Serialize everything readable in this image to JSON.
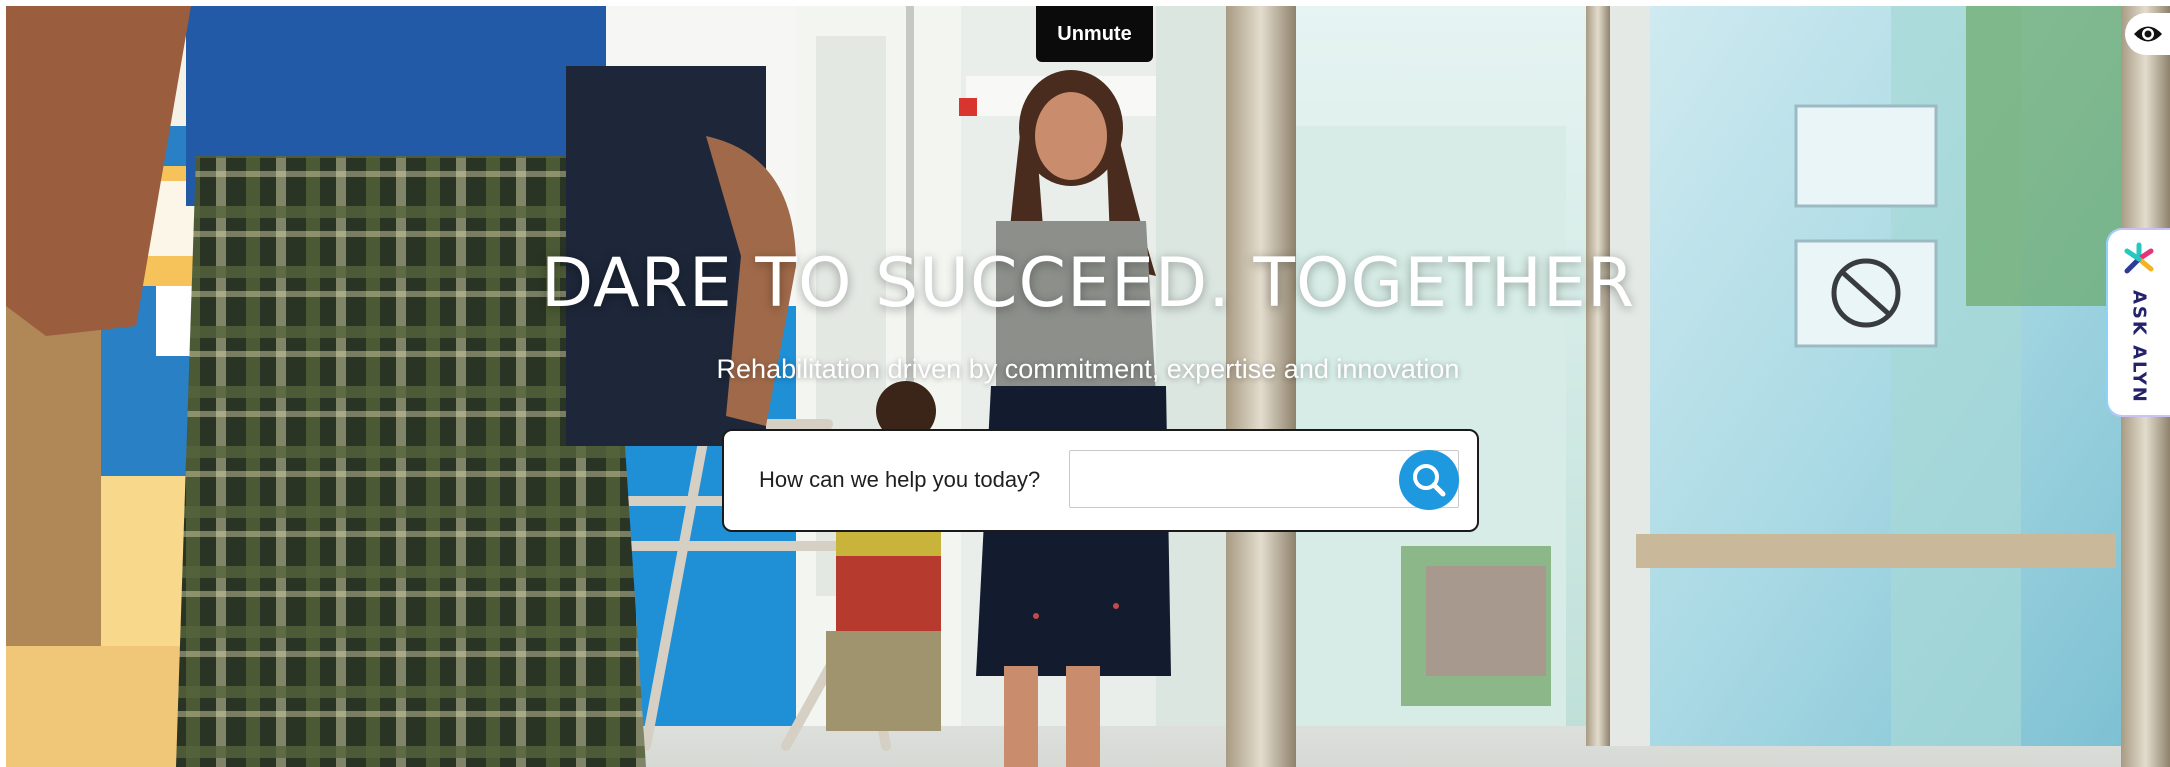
{
  "hero": {
    "unmute_label": "Unmute",
    "headline": "DARE TO SUCCEED. TOGETHER",
    "subheadline": "Rehabilitation driven by commitment, expertise and innovation",
    "background_icon": "hero-video-photo"
  },
  "search": {
    "label": "How can we help you today?",
    "value": "",
    "placeholder": "",
    "button_icon": "search-icon",
    "accent_color": "#1e98df"
  },
  "accessibility": {
    "icon": "eye-icon"
  },
  "ask_widget": {
    "label": "ASK ALYN",
    "icon": "alyn-asterisk-logo",
    "colors": [
      "#28c7c0",
      "#e8327a",
      "#f4b321",
      "#2c3b97"
    ]
  }
}
